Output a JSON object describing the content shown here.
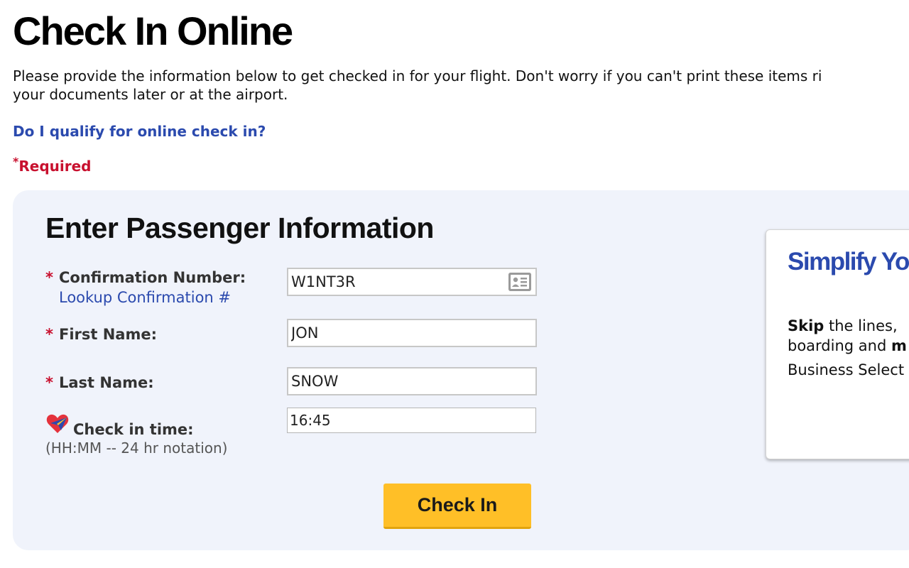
{
  "header": {
    "title": "Check In Online",
    "intro_line1": "Please provide the information below to get checked in for your flight. Don't worry if you can't print these items ri",
    "intro_line2": "your documents later or at the airport.",
    "qualify_link": "Do I qualify for online check in?",
    "required_star": "*",
    "required_label": "Required"
  },
  "form": {
    "title": "Enter Passenger Information",
    "required_marker": "*",
    "confirmation": {
      "label": "Confirmation Number:",
      "lookup_link": "Lookup Confirmation #",
      "value": "W1NT3R"
    },
    "first_name": {
      "label": "First Name:",
      "value": "JON"
    },
    "last_name": {
      "label": "Last Name:",
      "value": "SNOW"
    },
    "check_in_time": {
      "label": "Check in time:",
      "hint": "(HH:MM -- 24 hr notation)",
      "value": "16:45"
    },
    "submit_label": "Check In"
  },
  "promo": {
    "title": "Simplify Yo",
    "line1_bold": "Skip",
    "line1_rest": " the lines,",
    "line2_text": "boarding and ",
    "line2_bold": "m",
    "line3": "Business Select"
  },
  "colors": {
    "link_blue": "#2b4aae",
    "required_red": "#c8102e",
    "button_yellow": "#ffbf27",
    "panel_bg": "#f0f3fb"
  },
  "icons": [
    "id-card-icon",
    "heart-plane-icon"
  ]
}
